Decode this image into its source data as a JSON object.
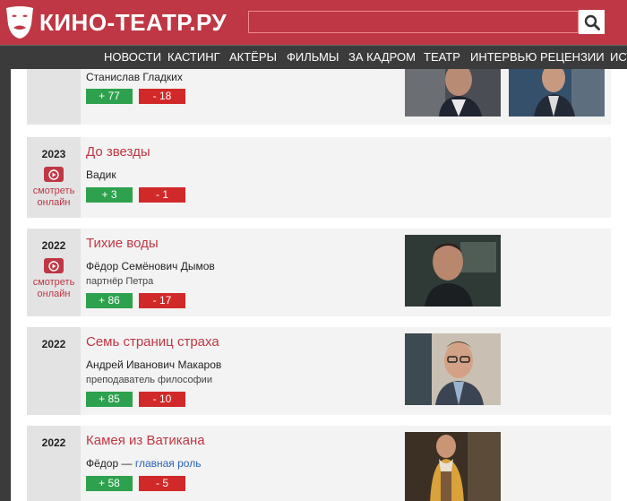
{
  "site": {
    "logo_text": "КИНО-ТЕАТР.РУ",
    "search_placeholder": ""
  },
  "nav": [
    "НОВОСТИ",
    "КАСТИНГ",
    "АКТЁРЫ",
    "ФИЛЬМЫ",
    "ЗА КАДРОМ",
    "ТЕАТР",
    "ИНТЕРВЬЮ",
    "РЕЦЕНЗИИ",
    "ИСТ"
  ],
  "watch_label_line1": "смотреть",
  "watch_label_line2": "онлайн",
  "films": [
    {
      "year": "",
      "title": "",
      "role": "Станислав Гладких",
      "role_desc": "",
      "up": "+ 77",
      "down": "- 18",
      "photos": 2
    },
    {
      "year": "2023",
      "title": "До звезды",
      "role": "Вадик",
      "role_desc": "",
      "up": "+ 3",
      "down": "- 1",
      "photos": 0,
      "watch": true
    },
    {
      "year": "2022",
      "title": "Тихие воды",
      "role": "Фёдор Семёнович Дымов",
      "role_desc": "партнёр Петра",
      "up": "+ 86",
      "down": "- 17",
      "photos": 1,
      "watch": true
    },
    {
      "year": "2022",
      "title": "Семь страниц страха",
      "role": "Андрей Иванович Макаров",
      "role_desc": "преподаватель философии",
      "up": "+ 85",
      "down": "- 10",
      "photos": 1
    },
    {
      "year": "2022",
      "title": "Камея из Ватикана",
      "role": "Фёдор",
      "role_sep": " — ",
      "role_link": "главная роль",
      "up": "+ 58",
      "down": "- 5",
      "photos": 1
    }
  ],
  "colors": {
    "brand": "#bf3744",
    "nav_bg": "#3b3b3b",
    "vote_up": "#2ea14e",
    "vote_down": "#d12929",
    "link": "#2a64b4"
  }
}
